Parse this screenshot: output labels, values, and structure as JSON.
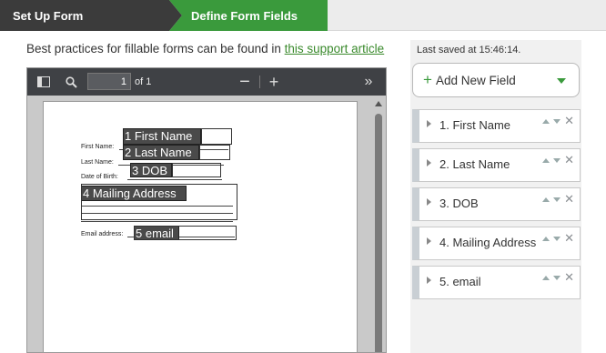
{
  "steps": [
    {
      "label": "Set Up Form"
    },
    {
      "label": "Define Form Fields"
    }
  ],
  "hint": {
    "text": "Best practices for fillable forms can be found in ",
    "link": "this support article"
  },
  "viewer": {
    "page_number": "1",
    "page_count": "of 1",
    "form_labels": {
      "first_name": "First Name:",
      "last_name": "Last Name:",
      "dob": "Date of Birth:",
      "email": "Email address:"
    },
    "fields": [
      {
        "label": "1 First Name"
      },
      {
        "label": "2 Last Name"
      },
      {
        "label": "3 DOB"
      },
      {
        "label": "4 Mailing Address"
      },
      {
        "label": "5 email"
      }
    ]
  },
  "sidebar": {
    "last_saved": "Last saved at 15:46:14.",
    "add_button": "Add New Field",
    "fields": [
      {
        "label": "1. First Name"
      },
      {
        "label": "2. Last Name"
      },
      {
        "label": "3. DOB"
      },
      {
        "label": "4. Mailing Address"
      },
      {
        "label": "5. email"
      }
    ]
  },
  "colors": {
    "accent_green": "#3a9a3c",
    "step_dark": "#3b3b3b",
    "viewer_toolbar": "#3f4145"
  },
  "icons": [
    "sidebar-toggle-icon",
    "search-icon",
    "zoom-out-icon",
    "zoom-in-icon",
    "more-tools-icon",
    "expand-triangle-icon",
    "move-up-icon",
    "move-down-icon",
    "close-icon",
    "plus-icon",
    "chevron-down-icon"
  ]
}
